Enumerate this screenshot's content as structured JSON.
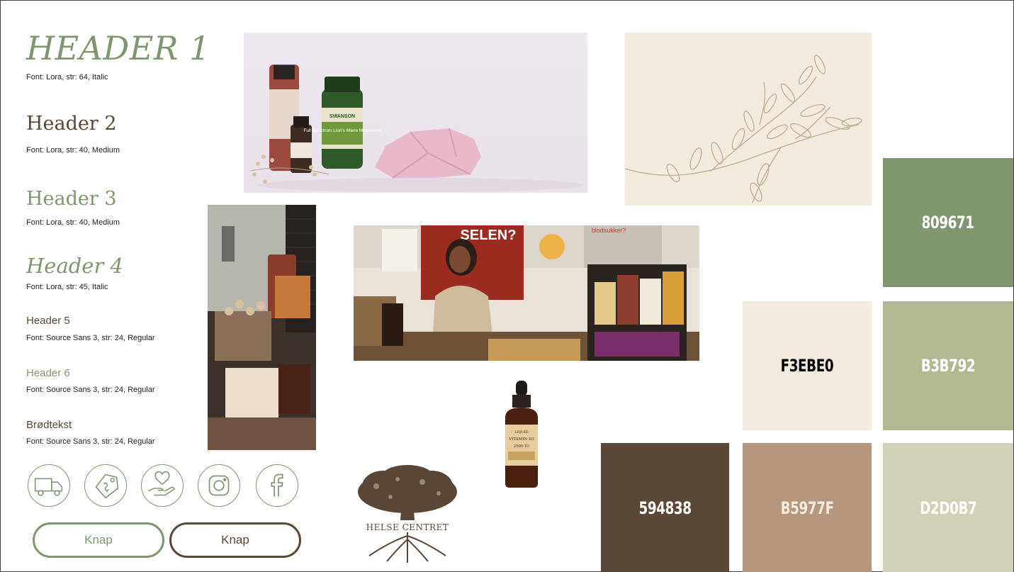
{
  "typography": {
    "h1": {
      "label": "HEADER 1",
      "spec": "Font: Lora, str: 64, Italic"
    },
    "h2": {
      "label": "Header 2",
      "spec": "Font: Lora, str: 40, Medium"
    },
    "h3": {
      "label": "Header 3",
      "spec": "Font: Lora, str: 40, Medium"
    },
    "h4": {
      "label": "Header 4",
      "spec": "Font: Lora, str: 45, Italic"
    },
    "h5": {
      "label": "Header 5",
      "spec": "Font: Source Sans 3, str: 24, Regular"
    },
    "h6": {
      "label": "Header 6",
      "spec": "Font: Source Sans 3, str: 24, Regular"
    },
    "body": {
      "label": "Brødtekst",
      "spec": "Font: Source Sans 3, str: 24, Regular"
    }
  },
  "icons": [
    "truck-icon",
    "price-tag-icon",
    "heart-hand-icon",
    "instagram-icon",
    "facebook-icon"
  ],
  "buttons": {
    "primary": "Knap",
    "secondary": "Knap"
  },
  "logo": {
    "text": "HELSE CENTRET"
  },
  "palette": [
    {
      "hex": "809671",
      "color": "#809671"
    },
    {
      "hex": "F3EBE0",
      "color": "#F3EBE0"
    },
    {
      "hex": "B3B792",
      "color": "#B3B792"
    },
    {
      "hex": "594838",
      "color": "#594838"
    },
    {
      "hex": "B5977F",
      "color": "#B5977F"
    },
    {
      "hex": "D2D0B7",
      "color": "#D2D0B7"
    }
  ],
  "photos": {
    "products": {
      "bottle_brand": "SWANSON",
      "bottle_label": "Full Spectrum Lion's Mane Mushroom"
    },
    "shop_poster": {
      "poster_text": "SELEN?",
      "poster_text_2": "blodsukker?"
    },
    "vitamin": {
      "label_line1": "LIQUID",
      "label_line2": "VITAMIN D3",
      "label_line3": "2500 IU"
    }
  }
}
